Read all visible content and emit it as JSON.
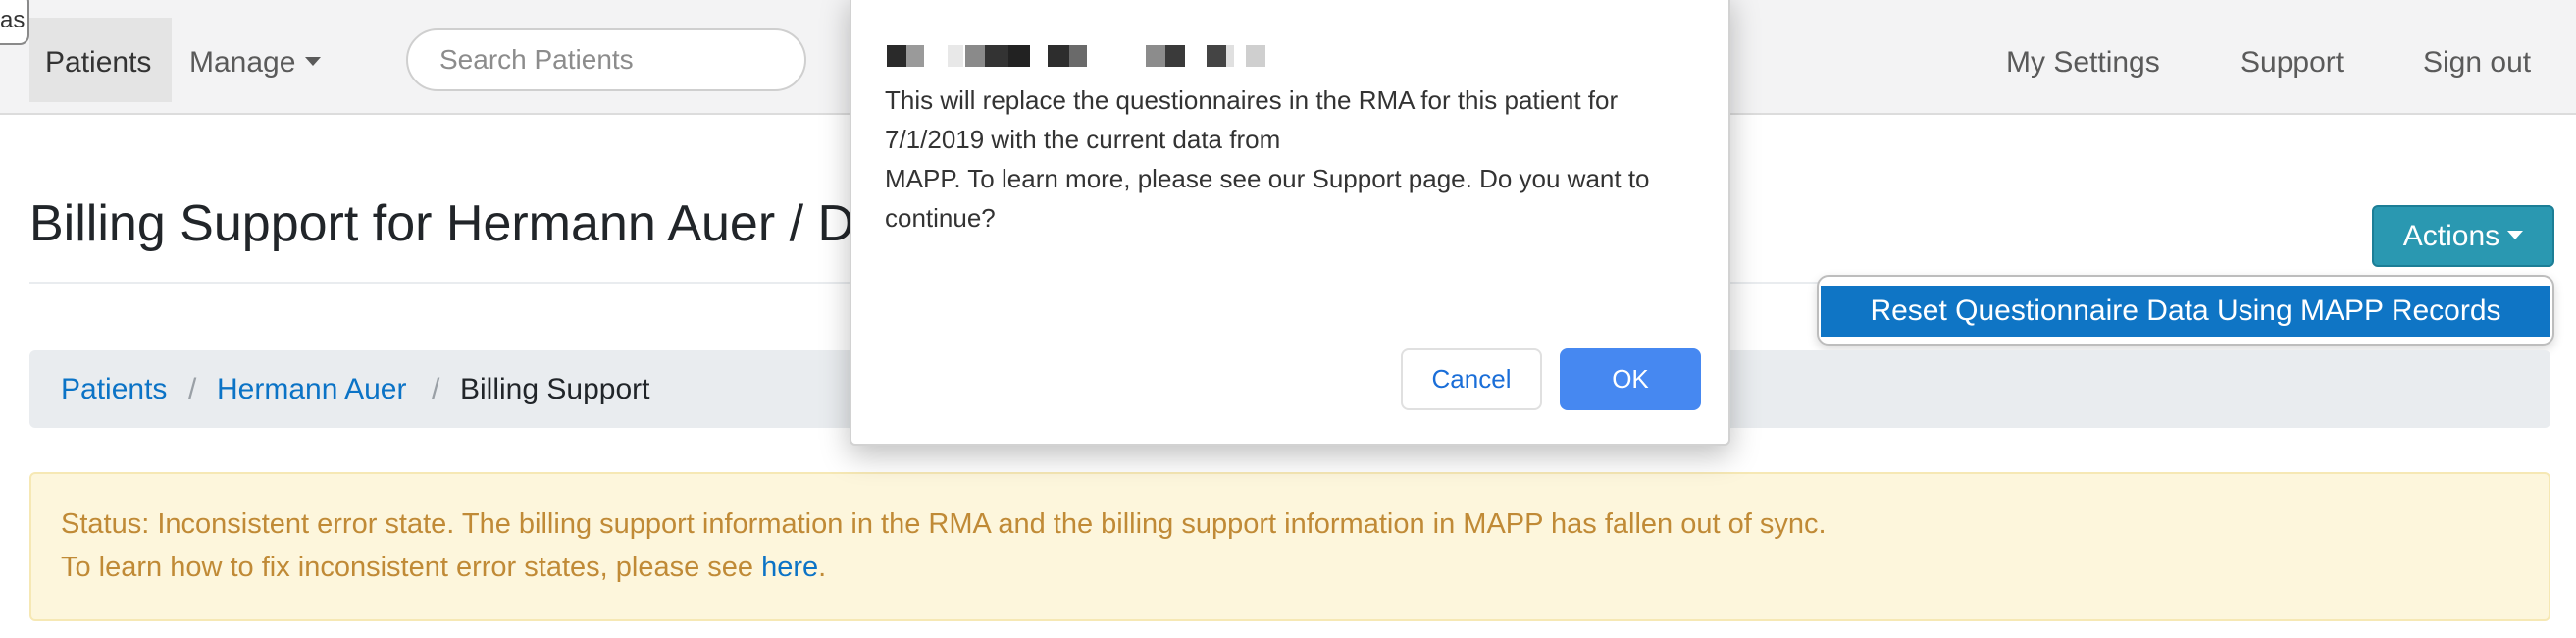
{
  "navbar": {
    "tab_fragment": "as",
    "patients_label": "Patients",
    "manage_label": "Manage",
    "search_placeholder": "Search Patients",
    "my_settings_label": "My Settings",
    "support_label": "Support",
    "sign_out_label": "Sign out"
  },
  "page": {
    "title": "Billing Support for Hermann Auer / D",
    "actions_label": "Actions",
    "actions_menu": {
      "items": [
        "Reset Questionnaire Data Using MAPP Records"
      ]
    },
    "breadcrumb": [
      "Patients",
      "Hermann Auer",
      "Billing Support"
    ],
    "breadcrumb_separator": "/",
    "alert": {
      "line1": "Status: Inconsistent error state. The billing support information in the RMA and the billing support information in MAPP has fallen out of sync.",
      "line2_prefix": "To learn how to fix inconsistent error states, please see ",
      "line2_link": "here",
      "line2_suffix": "."
    }
  },
  "dialog": {
    "message": "This will replace the questionnaires in the RMA for this patient for\n7/1/2019 with the current data from\nMAPP. To learn more, please see our Support page. Do you want to\ncontinue?",
    "cancel_label": "Cancel",
    "ok_label": "OK"
  },
  "colors": {
    "navbar_bg": "#f3f3f4",
    "actions_button": "#2a98b1",
    "dropdown_highlight": "#0f75c5",
    "link": "#0b73c6",
    "alert_bg": "#fdf6dc",
    "alert_text": "#c08a36",
    "ok_button": "#4688f1"
  },
  "icons": {
    "manage_caret": "caret-down-icon",
    "actions_caret": "caret-down-icon"
  }
}
